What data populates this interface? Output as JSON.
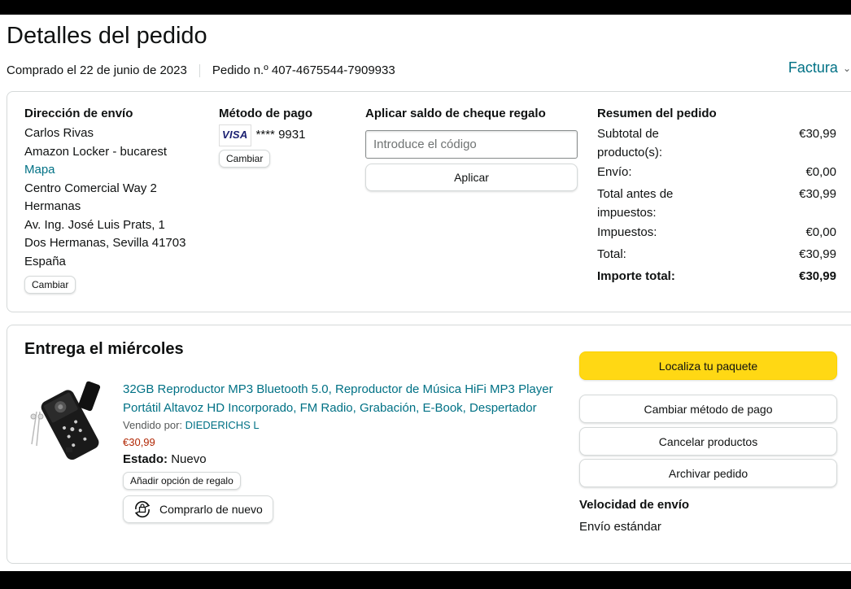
{
  "header": {
    "title": "Detalles del pedido",
    "purchased": "Comprado el 22 de junio de 2023",
    "order_number": "Pedido n.º 407-4675544-7909933",
    "invoice": "Factura"
  },
  "shipping": {
    "heading": "Dirección de envío",
    "name": "Carlos Rivas",
    "locker": "Amazon Locker - bucarest",
    "map_link": "Mapa",
    "line1": "Centro Comercial Way 2",
    "line2": "Hermanas",
    "line3": "Av. Ing. José Luis Prats, 1",
    "line4": "Dos Hermanas, Sevilla 41703",
    "country": "España",
    "change": "Cambiar"
  },
  "payment": {
    "heading": "Método de pago",
    "card_brand": "VISA",
    "card_digits": "**** 9931",
    "change": "Cambiar"
  },
  "gift": {
    "heading": "Aplicar saldo de cheque regalo",
    "placeholder": "Introduce el código",
    "apply": "Aplicar"
  },
  "summary": {
    "heading": "Resumen del pedido",
    "rows": [
      {
        "label": "Subtotal de producto(s):",
        "value": "€30,99"
      },
      {
        "label": "Envío:",
        "value": "€0,00"
      },
      {
        "label": "Total antes de impuestos:",
        "value": "€30,99"
      },
      {
        "label": "Impuestos:",
        "value": "€0,00"
      },
      {
        "label": "Total:",
        "value": "€30,99"
      }
    ],
    "grand_label": "Importe total:",
    "grand_value": "€30,99"
  },
  "delivery": {
    "heading": "Entrega el miércoles",
    "product_title": "32GB Reproductor MP3 Bluetooth 5.0, Reproductor de Música HiFi MP3 Player Portátil Altavoz HD Incorporado, FM Radio, Grabación, E-Book, Despertador",
    "seller_label": "Vendido por:",
    "seller": "DIEDERICHS L",
    "price": "€30,99",
    "condition_label": "Estado:",
    "condition": "Nuevo",
    "gift_option": "Añadir opción de regalo",
    "buy_again": "Comprarlo de nuevo"
  },
  "actions": {
    "track": "Localiza tu paquete",
    "change_payment": "Cambiar método de pago",
    "cancel": "Cancelar productos",
    "archive": "Archivar pedido",
    "speed_heading": "Velocidad de envío",
    "speed": "Envío estándar"
  },
  "colors": {
    "link": "#007185",
    "price": "#b12704",
    "accent_button": "#ffd814",
    "border": "#d5d9d9"
  },
  "icons": {
    "invoice_chevron": "chevron-down-icon",
    "buy_again": "buy-again-icon"
  }
}
